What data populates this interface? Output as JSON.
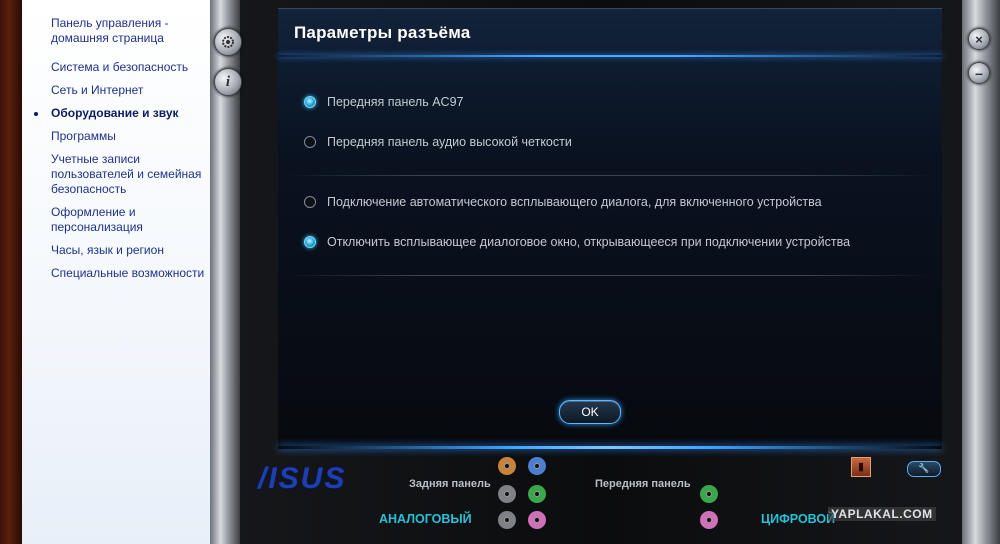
{
  "sidebar": {
    "items": [
      {
        "label": "Панель управления - домашняя страница"
      },
      {
        "label": "Система и безопасность"
      },
      {
        "label": "Сеть и Интернет"
      },
      {
        "label": "Оборудование и звук"
      },
      {
        "label": "Программы"
      },
      {
        "label": "Учетные записи пользователей и семейная безопасность"
      },
      {
        "label": "Оформление и персонализация"
      },
      {
        "label": "Часы, язык и регион"
      },
      {
        "label": "Специальные возможности"
      }
    ],
    "active_index": 3
  },
  "dialog": {
    "title": "Параметры разъёма",
    "options": [
      {
        "label": "Передняя панель AC97",
        "selected": true
      },
      {
        "label": "Передняя панель аудио высокой четкости",
        "selected": false
      },
      {
        "label": "Подключение автоматического всплывающего диалога, для включенного устройства",
        "selected": false
      },
      {
        "label": "Отключить всплывающее диалоговое окно, открывающееся при подключении устройства",
        "selected": true
      }
    ],
    "ok_label": "OK"
  },
  "bottom": {
    "logo": "/ISUS",
    "rear_panel_label": "Задняя панель",
    "front_panel_label": "Передняя панель",
    "analog_label": "АНАЛОГОВЫЙ",
    "digital_label": "ЦИФРОВОЙ",
    "jack_colors": {
      "orange": "#c8843a",
      "blue": "#4d7fd0",
      "gray": "#7e8186",
      "green": "#3aa84a",
      "pink": "#d070b8"
    }
  },
  "watermark": "YAPLAKAL.COM",
  "icons": {
    "settings": "gear-icon",
    "info": "info-icon",
    "close": "close-icon",
    "minimize": "minimize-icon"
  }
}
